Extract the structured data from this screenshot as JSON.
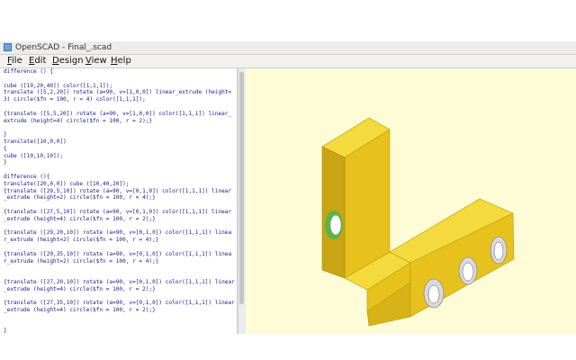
{
  "window": {
    "title": "OpenSCAD - Final_.scad"
  },
  "menu": {
    "items": [
      "File",
      "Edit",
      "Design",
      "View",
      "Help"
    ]
  },
  "editor": {
    "lines": [
      "difference () {",
      "",
      "cube ([10,20,40]) color([1,1,1]);",
      "translate ([5,2,20]) rotate (a=90, v=[1,0,0]) linear_extrude (height=",
      "3) circle($fn = 100, r = 4) color([1,1,1]);",
      "",
      "{translate ([5,5,20]) rotate (a=90, v=[1,0,0]) color([1,1,1]) linear_",
      "extrude (height=4) circle($fn = 100, r = 2);}",
      "",
      "}",
      "translate([10,0,0])",
      "{",
      "cube ([10,10,10]);",
      "}",
      "",
      "difference (){",
      "translate([20,0,0]) cube ([10,40,20]);",
      "{translate ([29,5,10]) rotate (a=90, v=[0,1,0]) color([1,1,1]) linear",
      "_extrude (height=2) circle($fn = 100, r = 4);}",
      "",
      "{translate ([27,5,10]) rotate (a=90, v=[0,1,0]) color([1,1,1]) linear",
      "_extrude (height=4) circle($fn = 100, r = 2);}",
      "",
      "{translate ([29,20,10]) rotate (a=90, v=[0,1,0]) color([1,1,1]) linea",
      "r_extrude (height=2) circle($fn = 100, r = 4);}",
      "",
      "{translate ([29,35,10]) rotate (a=90, v=[0,1,0]) color([1,1,1]) linea",
      "r_extrude (height=2) circle($fn = 100, r = 4);}",
      "",
      "",
      "{translate ([27,20,10]) rotate (a=90, v=[0,1,0]) color([1,1,1]) linear",
      "_extrude (height=4) circle($fn = 100, r = 2);}",
      "",
      "{translate ([27,35,10]) rotate (a=90, v=[0,1,0]) color([1,1,1]) linear",
      "_extrude (height=4) circle($fn = 100, r = 2);}",
      "",
      "",
      "}"
    ]
  },
  "viewport": {
    "background": "#fdfcd6",
    "model_colors": {
      "top": "#f4da3c",
      "front": "#e7c21d",
      "side": "#c9a414",
      "hole_ring": "#57b84a",
      "hole": "#ffffff"
    }
  }
}
